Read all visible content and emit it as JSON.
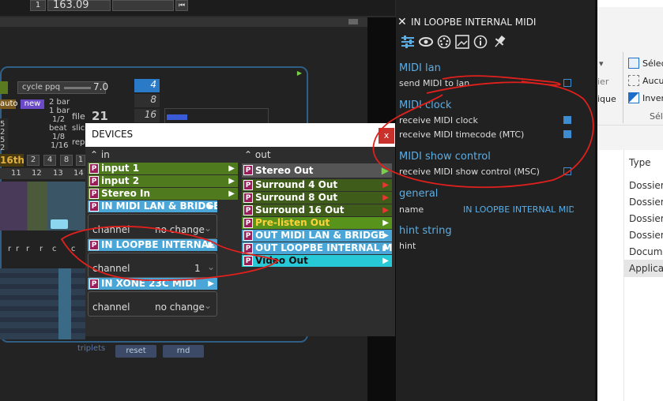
{
  "topbar": {
    "value": "163.09",
    "field1": "1"
  },
  "editor": {
    "cycle_label": "cycle ppq",
    "cycle_value": "7.0",
    "auto_label": "auto",
    "new_label": "new",
    "grid_options": [
      "2 bar",
      "1 bar",
      "1/2",
      "beat",
      "1/8",
      "1/16"
    ],
    "file_label": "file",
    "file_value": "21",
    "slice_label": "slice",
    "rep_label": "rep",
    "res_label": "16th",
    "res_options": [
      "2",
      "4",
      "8",
      "1"
    ],
    "ruler": [
      "11",
      "12",
      "13",
      "14"
    ],
    "steps": [
      "4",
      "8",
      "16"
    ],
    "rows_left": [
      "5",
      "2",
      "5",
      "2"
    ],
    "triplets_label": "triplets",
    "reset_label": "reset",
    "rnd_label": "rnd",
    "lane_letters": [
      "r",
      "r",
      "r",
      "r",
      "c",
      "c"
    ]
  },
  "devices": {
    "title": "DEVICES",
    "close": "x",
    "in_header": "in",
    "out_header": "out",
    "inputs": [
      {
        "label": "input 1"
      },
      {
        "label": "input 2"
      },
      {
        "label": "Stereo In"
      },
      {
        "label": "IN MIDI LAN & BRIDGE"
      },
      {
        "label": "IN LOOPBE INTERNAL M"
      },
      {
        "label": "IN XONE 23C MIDI"
      }
    ],
    "channel_label": "channel",
    "channel_values": [
      "no change",
      "1",
      "no change"
    ],
    "outputs": [
      {
        "label": "Stereo Out"
      },
      {
        "label": "Surround 4 Out"
      },
      {
        "label": "Surround 8 Out"
      },
      {
        "label": "Surround 16 Out"
      },
      {
        "label": "Pre-listen Out"
      },
      {
        "label": "OUT MIDI LAN & BRIDGE"
      },
      {
        "label": "OUT LOOPBE INTERNAL MID"
      },
      {
        "label": "Video Out"
      }
    ],
    "p_badge": "P"
  },
  "panel": {
    "title": "IN LOOPBE INTERNAL MIDI",
    "midi_lan": {
      "heading": "MIDI lan",
      "send_label": "send MIDI to lan",
      "send_checked": false
    },
    "midi_clock": {
      "heading": "MIDI clock",
      "receive_clock": "receive MIDI clock",
      "clock_checked": true,
      "receive_mtc": "receive MIDI timecode (MTC)",
      "mtc_checked": true
    },
    "midi_show": {
      "heading": "MIDI show control",
      "receive_msc": "receive MIDI show control (MSC)",
      "msc_checked": false
    },
    "general": {
      "heading": "general",
      "name_label": "name",
      "name_value": "IN LOOPBE INTERNAL MIDI"
    },
    "hint": {
      "heading": "hint string",
      "hint_label": "hint"
    }
  },
  "explorer": {
    "ribbon": [
      "Sélec",
      "Aucu",
      "Inver",
      "Sél"
    ],
    "ribbon_left": [
      "ier",
      "ique"
    ],
    "type_header": "Type",
    "items": [
      "Dossier",
      "Dossier",
      "Dossier",
      "Dossier",
      "Docume",
      "Applicat"
    ]
  },
  "colors": {
    "accent_blue": "#5aaee6",
    "close_red": "#c8312c",
    "annotation_red": "#e0201c"
  }
}
